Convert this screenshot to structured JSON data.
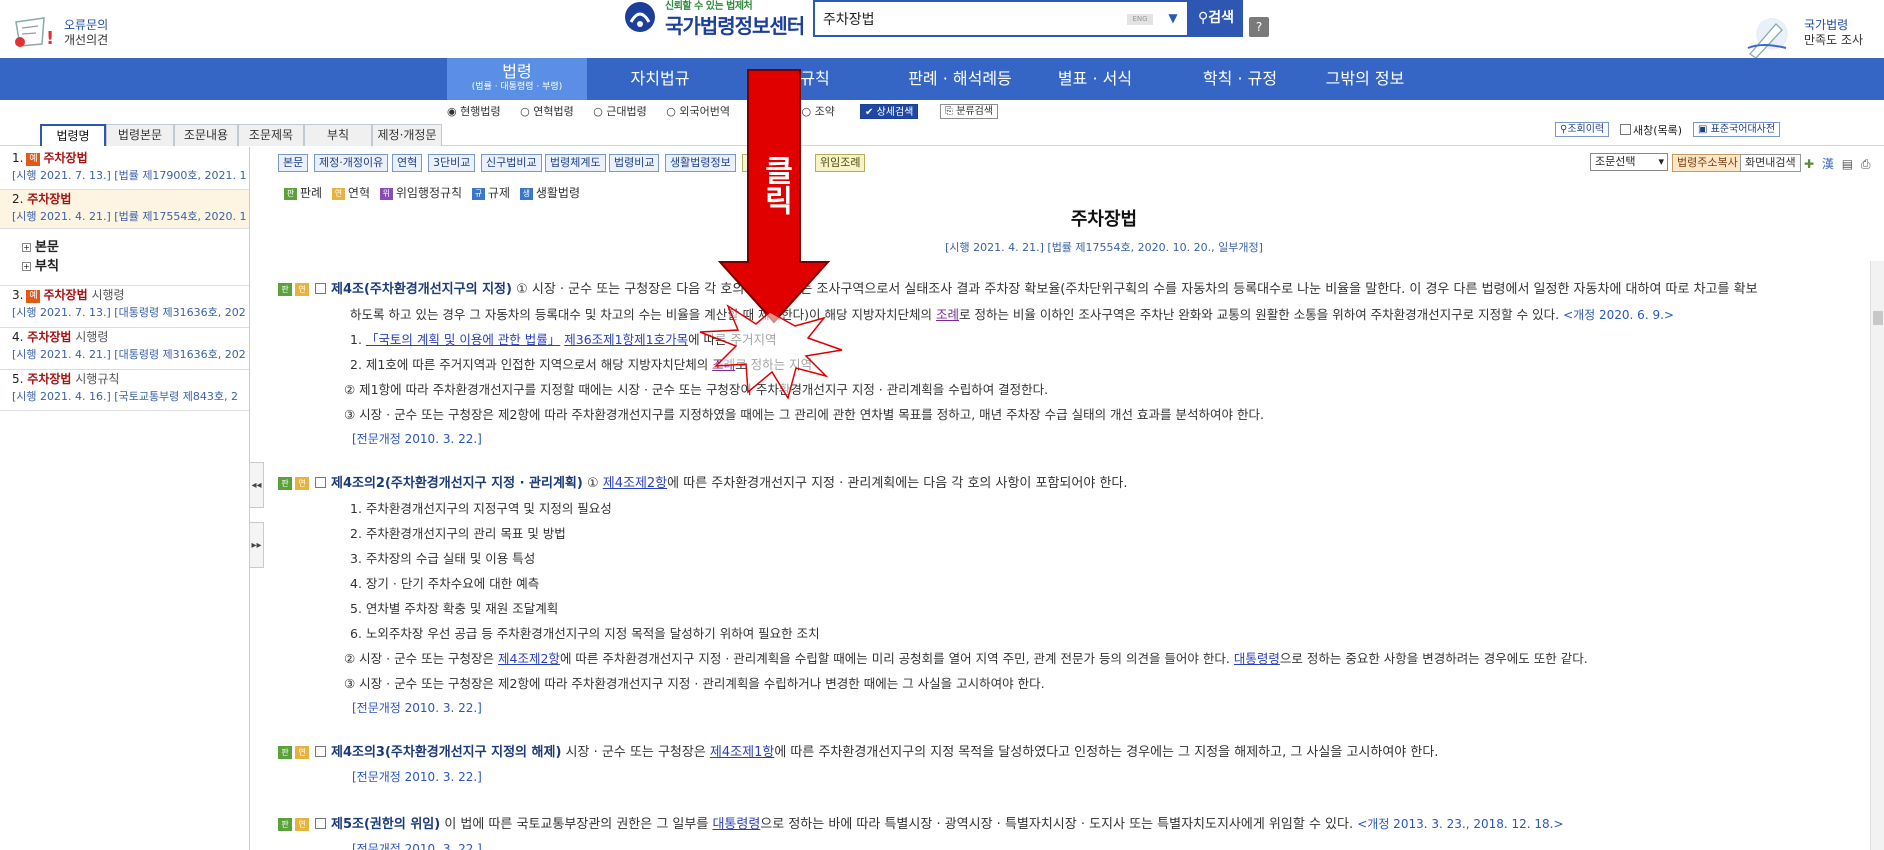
{
  "header": {
    "feedback_line1": "오류문의",
    "feedback_line2": "개선의견",
    "logo_slogan": "신뢰할 수 있는 법제처",
    "logo_name": "국가법령정보센터",
    "search_value": "주차장법",
    "search_button": "검색",
    "help_button": "?",
    "survey_line1": "국가법령",
    "survey_line2": "만족도 조사"
  },
  "nav": {
    "items": [
      {
        "label": "법령",
        "sub": "(법률 · 대통령령 · 부령)"
      },
      {
        "label": "자치법규"
      },
      {
        "label": "규칙"
      },
      {
        "label": "판례 · 해석례등"
      },
      {
        "label": "별표 · 서식"
      },
      {
        "label": "학칙 · 규정"
      },
      {
        "label": "그밖의 정보"
      }
    ]
  },
  "filters": {
    "radios": [
      "현행법령",
      "연혁법령",
      "근대법령",
      "외국어번역",
      "조약"
    ],
    "detail_search": "상세검색",
    "category_search": "분류검색",
    "view_history": "조회이력",
    "new_window": "새창(목록)",
    "dictionary": "표준국어대사전"
  },
  "tabs": [
    "법령명",
    "법령본문",
    "조문내용",
    "조문제목",
    "부칙",
    "제정·개정문"
  ],
  "sidebar": {
    "items": [
      {
        "num": "1.",
        "badge": "예",
        "name": "주차장법",
        "suffix": "",
        "info": "[시행 2021. 7. 13.] [법률 제17900호, 2021. 1"
      },
      {
        "num": "2.",
        "badge": "",
        "name": "주차장법",
        "suffix": "",
        "info": "[시행 2021. 4. 21.] [법률 제17554호, 2020. 1"
      },
      {
        "num": "3.",
        "badge": "예",
        "name": "주차장법",
        "suffix": " 시행령",
        "info": "[시행 2021. 7. 13.] [대통령령 제31636호, 202"
      },
      {
        "num": "4.",
        "badge": "",
        "name": "주차장법",
        "suffix": " 시행령",
        "info": "[시행 2021. 4. 21.] [대통령령 제31636호, 202"
      },
      {
        "num": "5.",
        "badge": "",
        "name": "주차장법",
        "suffix": " 시행규칙",
        "info": "[시행 2021. 4. 16.] [국토교통부령 제843호, 2"
      }
    ],
    "tree": [
      "본문",
      "부칙"
    ]
  },
  "toolbar": {
    "buttons": [
      "본문",
      "제정·개정이유",
      "연혁",
      "3단비교",
      "신구법비교",
      "법령체계도",
      "법령비교",
      "생활법령정보",
      "위임조례"
    ],
    "select": "조문선택",
    "copy_addr": "법령주소복사",
    "save_screen": "화면내검색"
  },
  "legend": [
    "판례",
    "연혁",
    "위임행정규칙",
    "규제",
    "생활법령"
  ],
  "document": {
    "title": "주차장법",
    "subtitle": "[시행 2021. 4. 21.] [법률 제17554호, 2020. 10. 20., 일부개정]",
    "art4_title": "제4조(주차환경개선지구의 지정)",
    "art4_body": "① 시장 · 군수 또는 구청장은 다음 각 호의 지역에 있는 조사구역으로서 실태조사 결과 주차장 확보율(주차단위구획의 수를 자동차의 등록대수로 나눈 비율을 말한다. 이 경우 다른 법령에서 일정한 자동차에 대하여 따로 차고를 확보",
    "art4_body2a": "하도록 하고 있는 경우 그 자동차의 등록대수 및 차고의 수는 비율을 계산할 때 제외한다)이 해당 지방자치단체의 ",
    "ordinance": "조례",
    "art4_body2b": "로 정하는 비율 이하인 조사구역은 주차난 완화와 교통의 원활한 소통을 위하여 주차환경개선지구로 지정할 수 있다.",
    "art4_rev": "<개정 2020. 6. 9.>",
    "art4_i1_num": "1. ",
    "art4_i1_link": "「국토의 계획 및 이용에 관한 법률」",
    "art4_i1_link2": "제36조제1항제1호가목",
    "art4_i1_rest": "에 따른 주거지역",
    "art4_i2a": "2. 제1호에 따른 주거지역과 인접한 지역으로서 해당 지방자치단체의 ",
    "art4_i2b": "로 정하는 지역",
    "art4_p2": "② 제1항에 따라 주차환경개선지구를 지정할 때에는 시장 · 군수 또는 구청장이 주차환경개선지구 지정 · 관리계획을 수립하여 결정한다.",
    "art4_p3": "③ 시장 · 군수 또는 구청장은 제2항에 따라 주차환경개선지구를 지정하였을 때에는 그 관리에 관한 연차별 목표를 정하고, 매년 주차장 수급 실태의 개선 효과를 분석하여야 한다.",
    "full_rev1": "[전문개정 2010. 3. 22.]",
    "art42_title": "제4조의2(주차환경개선지구 지정 · 관리계획)",
    "art42_body_a": "① ",
    "art42_link": "제4조제2항",
    "art42_body_b": "에 따른 주차환경개선지구 지정 · 관리계획에는 다음 각 호의 사항이 포함되어야 한다.",
    "art42_items": [
      "1. 주차환경개선지구의 지정구역 및 지정의 필요성",
      "2. 주차환경개선지구의 관리 목표 및 방법",
      "3. 주차장의 수급 실태 및 이용 특성",
      "4. 장기 · 단기 주차수요에 대한 예측",
      "5. 연차별 주차장 확충 및 재원 조달계획",
      "6. 노외주차장 우선 공급 등 주차환경개선지구의 지정 목적을 달성하기 위하여 필요한 조치"
    ],
    "art42_p2a": "② 시장 · 군수 또는 구청장은 ",
    "art42_p2link": "제4조제2항",
    "art42_p2b": "에 따른 주차환경개선지구 지정 · 관리계획을 수립할 때에는 미리 공청회를 열어 지역 주민, 관계 전문가 등의 의견을 들어야 한다. ",
    "art42_p2link2": "대통령령",
    "art42_p2c": "으로 정하는 중요한 사항을 변경하려는 경우에도 또한 같다.",
    "art42_p3": "③ 시장 · 군수 또는 구청장은 제2항에 따라 주차환경개선지구 지정 · 관리계획을 수립하거나 변경한 때에는 그 사실을 고시하여야 한다.",
    "full_rev2": "[전문개정 2010. 3. 22.]",
    "art43_title": "제4조의3(주차환경개선지구 지정의 해제)",
    "art43_a": " 시장 · 군수 또는 구청장은 ",
    "art43_link": "제4조제1항",
    "art43_b": "에 따른 주차환경개선지구의 지정 목적을 달성하였다고 인정하는 경우에는 그 지정을 해제하고, 그 사실을 고시하여야 한다.",
    "full_rev3": "[전문개정 2010. 3. 22.]",
    "art5_title": "제5조(권한의 위임)",
    "art5_a": " 이 법에 따른 국토교통부장관의 권한은 그 일부를 ",
    "art5_link": "대통령령",
    "art5_b": "으로 정하는 바에 따라 특별시장 · 광역시장 · 특별자치시장 · 도지사 또는 특별자치도지사에게 위임할 수 있다.",
    "art5_rev": "<개정 2013. 3. 23., 2018. 12. 18.>",
    "full_rev4": "[전문개정 2010. 3. 22.]"
  },
  "annotation": {
    "text": "클릭",
    "arrow_color": "#e00000"
  }
}
